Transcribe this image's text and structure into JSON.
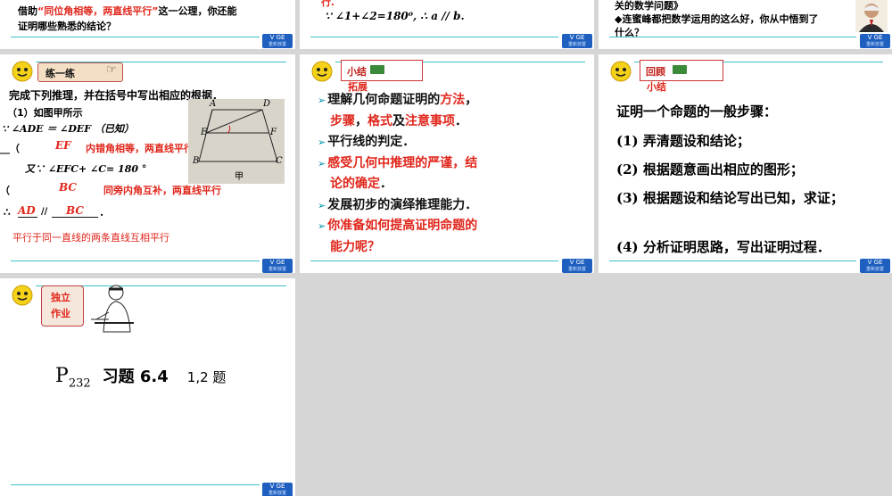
{
  "slide1": {
    "text_a": "借助",
    "text_b": "“同位角相等，两直线平行”",
    "text_c": "这一公理，你还能",
    "line2": "证明哪些熟悉的结论？"
  },
  "slide2": {
    "partial_top": "行.",
    "formula": "∵ ∠1+∠2=180⁰, ∴ a // b."
  },
  "slide3": {
    "line1": "关的数学问题》",
    "line2": "◆连蜜峰都把数学运用的这么好，你从中悟到了",
    "line3": "什么？"
  },
  "slide4": {
    "tag": "练一练",
    "intro": "完成下列推理，并在括号中写出相应的根据．",
    "q1": "（1）如图甲所示",
    "given": "∵ ∠ADE ＝ ∠DEF （已知）",
    "blank1_prefix": "__（",
    "blank1_close": "）",
    "ans_ef": "EF",
    "reason1": "内错角相等，两直线平行",
    "given2": "又∵ ∠EFC+ ∠C= 180 °",
    "paren_open": "（",
    "ans_bc": "BC",
    "reason2": "同旁内角互补，两直线平行",
    "concl_prefix": "∴",
    "ans_ad": "AD",
    "parallel": "//",
    "ans_bc2": "BC",
    "concl_end": ".",
    "reason3": "平行于同一直线的两条直线互相平行",
    "figure": {
      "A": "A",
      "D": "D",
      "E": "E",
      "F": "F",
      "B": "B",
      "C": "C",
      "caption": "甲"
    }
  },
  "slide5": {
    "tag1": "小结",
    "tag2": "拓展",
    "items": [
      {
        "parts": [
          {
            "t": "理解几何命题证明的",
            "c": "blk"
          },
          {
            "t": "方法",
            "c": "red"
          },
          {
            "t": "，",
            "c": "blk"
          }
        ]
      },
      {
        "parts": [
          {
            "t": "步骤",
            "c": "red"
          },
          {
            "t": "，",
            "c": "blk"
          },
          {
            "t": "格式",
            "c": "red"
          },
          {
            "t": "及",
            "c": "blk"
          },
          {
            "t": "注意事项",
            "c": "red"
          },
          {
            "t": "．",
            "c": "blk"
          }
        ]
      },
      {
        "parts": [
          {
            "t": "平行线的判定",
            "c": "blk"
          },
          {
            "t": "．",
            "c": "blk"
          }
        ]
      },
      {
        "parts": [
          {
            "t": "感受几何中推理的严谨，结",
            "c": "red"
          }
        ]
      },
      {
        "parts": [
          {
            "t": "论的确定",
            "c": "red"
          },
          {
            "t": "．",
            "c": "blk"
          }
        ]
      },
      {
        "parts": [
          {
            "t": "发展初步的演绎推理能力",
            "c": "blk"
          },
          {
            "t": "．",
            "c": "blk"
          }
        ]
      },
      {
        "parts": [
          {
            "t": "你准备如何提高证明命题的",
            "c": "red"
          }
        ]
      },
      {
        "parts": [
          {
            "t": "能力呢？",
            "c": "red"
          }
        ]
      }
    ]
  },
  "slide6": {
    "tag1": "回顾",
    "tag2": "小结",
    "title": "证明一个命题的一般步骤：",
    "steps": [
      "(1) 弄清题设和结论；",
      "(2) 根据题意画出相应的图形；",
      "(3) 根据题设和结论写出已知，求证；",
      "(4) 分析证明思路，写出证明过程．"
    ]
  },
  "slide7": {
    "tag1": "独立",
    "tag2": "作业",
    "hw_p": "P",
    "hw_sub": "232",
    "hw_mid": "习题 6.4",
    "hw_end": "1,2 题"
  },
  "logo": {
    "main": "V GE",
    "sub": "重新放置"
  }
}
